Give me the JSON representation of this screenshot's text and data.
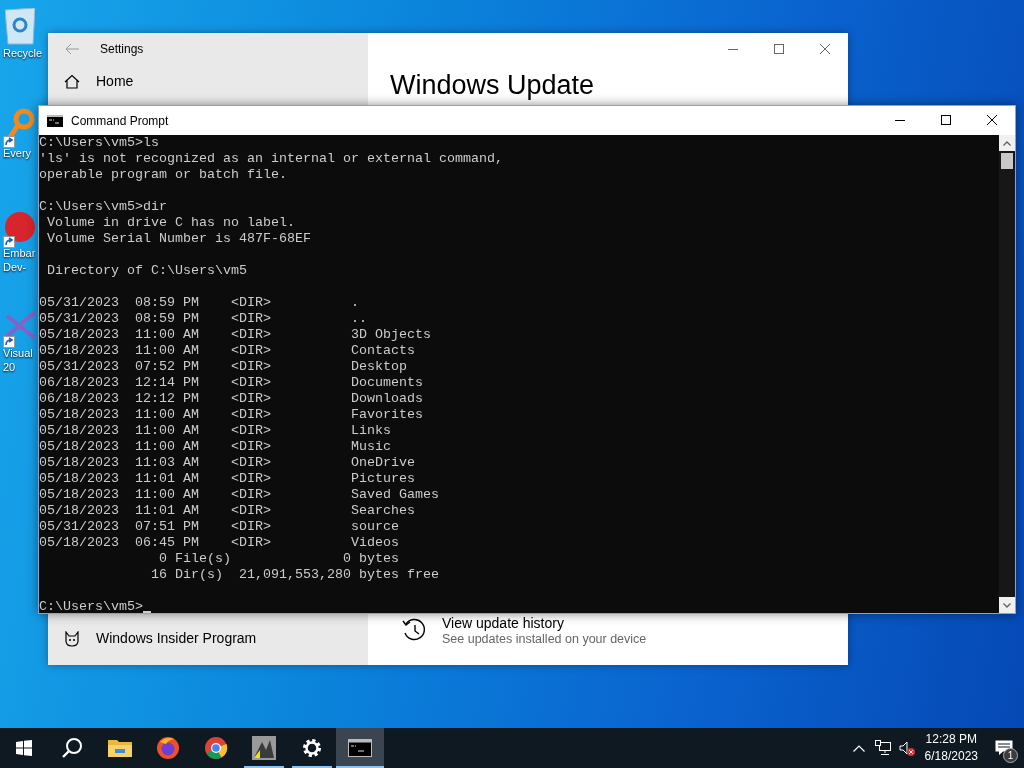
{
  "desktop_icons": [
    {
      "kind": "recycle-bin",
      "shortcut": false,
      "label": [
        "Recycle"
      ]
    },
    {
      "kind": "everything",
      "shortcut": true,
      "label": [
        "Every"
      ]
    },
    {
      "kind": "embarcadero",
      "shortcut": true,
      "label": [
        "Embar",
        "Dev-"
      ]
    },
    {
      "kind": "visual-studio",
      "shortcut": true,
      "label": [
        "Visual",
        "20"
      ]
    }
  ],
  "settings_window": {
    "title": "Settings",
    "nav": [
      {
        "kind": "home",
        "label": "Home"
      },
      {
        "kind": "insider",
        "label": "Windows Insider Program"
      }
    ],
    "heading": "Windows Update",
    "items": [
      {
        "kind": "history",
        "title": "View update history",
        "subtitle": "See updates installed on your device"
      }
    ]
  },
  "cmd_window": {
    "title": "Command Prompt",
    "cursor": true,
    "blocks": [
      [
        "C:\\Users\\vm5>ls",
        "'ls' is not recognized as an internal or external command,",
        "operable program or batch file."
      ],
      [
        "C:\\Users\\vm5>dir",
        " Volume in drive C has no label.",
        " Volume Serial Number is 487F-68EF"
      ],
      [
        " Directory of C:\\Users\\vm5"
      ],
      [
        "05/31/2023  08:59 PM    <DIR>          .",
        "05/31/2023  08:59 PM    <DIR>          ..",
        "05/18/2023  11:00 AM    <DIR>          3D Objects",
        "05/18/2023  11:00 AM    <DIR>          Contacts",
        "05/31/2023  07:52 PM    <DIR>          Desktop",
        "06/18/2023  12:14 PM    <DIR>          Documents",
        "06/18/2023  12:12 PM    <DIR>          Downloads",
        "05/18/2023  11:00 AM    <DIR>          Favorites",
        "05/18/2023  11:00 AM    <DIR>          Links",
        "05/18/2023  11:00 AM    <DIR>          Music",
        "05/18/2023  11:03 AM    <DIR>          OneDrive",
        "05/18/2023  11:01 AM    <DIR>          Pictures",
        "05/18/2023  11:00 AM    <DIR>          Saved Games",
        "05/18/2023  11:01 AM    <DIR>          Searches",
        "05/31/2023  07:51 PM    <DIR>          source",
        "05/18/2023  06:45 PM    <DIR>          Videos",
        "               0 File(s)              0 bytes",
        "              16 Dir(s)  21,091,553,280 bytes free"
      ],
      [
        "C:\\Users\\vm5>"
      ]
    ]
  },
  "taskbar": {
    "apps": [
      {
        "kind": "start",
        "running": false,
        "selected": false
      },
      {
        "kind": "search",
        "running": false,
        "selected": false
      },
      {
        "kind": "explorer",
        "running": false,
        "selected": false
      },
      {
        "kind": "firefox",
        "running": false,
        "selected": false
      },
      {
        "kind": "chrome",
        "running": false,
        "selected": false
      },
      {
        "kind": "app",
        "running": true,
        "selected": false
      },
      {
        "kind": "settings",
        "running": true,
        "selected": false
      },
      {
        "kind": "cmd",
        "running": true,
        "selected": true
      }
    ],
    "tray": {
      "time": "12:28 PM",
      "date": "6/18/2023",
      "volume_muted": true,
      "notifications": "1"
    }
  }
}
